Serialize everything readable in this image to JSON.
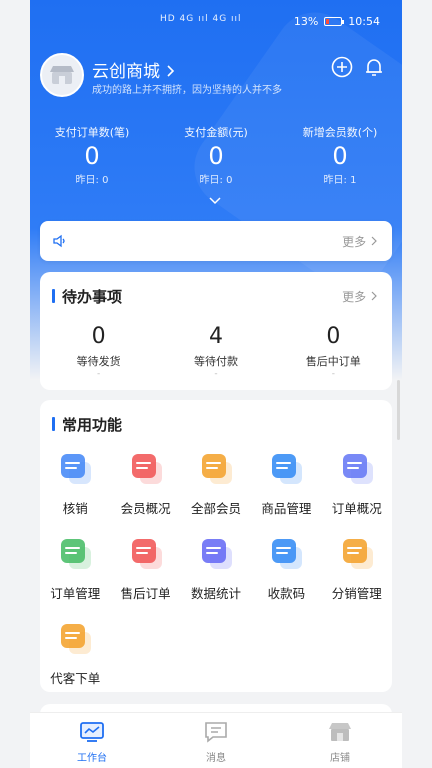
{
  "status_bar": {
    "battery": "13%",
    "time": "10:54",
    "signal": "HD 4G ııl 4G ııl"
  },
  "header": {
    "store_name": "云创商城",
    "slogan": "成功的路上并不拥挤，因为坚持的人并不多"
  },
  "stats": [
    {
      "label": "支付订单数(笔)",
      "value": "0",
      "yesterday": "昨日: 0"
    },
    {
      "label": "支付金额(元)",
      "value": "0",
      "yesterday": "昨日: 0"
    },
    {
      "label": "新增会员数(个)",
      "value": "0",
      "yesterday": "昨日: 1"
    }
  ],
  "notice": {
    "more": "更多"
  },
  "todo": {
    "title": "待办事项",
    "more": "更多",
    "items": [
      {
        "count": "0",
        "label": "等待发货",
        "dash": "-"
      },
      {
        "count": "4",
        "label": "等待付款",
        "dash": "-"
      },
      {
        "count": "0",
        "label": "售后中订单",
        "dash": "-"
      }
    ]
  },
  "functions": {
    "title": "常用功能",
    "items": [
      {
        "label": "核销",
        "icon": "verify-icon",
        "color": "#4a8cf7"
      },
      {
        "label": "会员概况",
        "icon": "member-overview-icon",
        "color": "#f25b5b"
      },
      {
        "label": "全部会员",
        "icon": "all-members-icon",
        "color": "#f4a533"
      },
      {
        "label": "商品管理",
        "icon": "cart-icon",
        "color": "#3a8ff5"
      },
      {
        "label": "订单概况",
        "icon": "order-overview-icon",
        "color": "#6a7cf5"
      },
      {
        "label": "订单管理",
        "icon": "order-manage-icon",
        "color": "#4cbf6a"
      },
      {
        "label": "售后订单",
        "icon": "after-sale-icon",
        "color": "#f25b5b"
      },
      {
        "label": "数据统计",
        "icon": "chart-icon",
        "color": "#6a6ff5"
      },
      {
        "label": "收款码",
        "icon": "payment-code-icon",
        "color": "#3a8ff5"
      },
      {
        "label": "分销管理",
        "icon": "distribution-icon",
        "color": "#f4a533"
      },
      {
        "label": "代客下单",
        "icon": "proxy-order-icon",
        "color": "#f4a533"
      }
    ]
  },
  "tabbar": [
    {
      "label": "工作台",
      "icon": "workbench-icon",
      "active": true
    },
    {
      "label": "消息",
      "icon": "message-icon",
      "active": false
    },
    {
      "label": "店铺",
      "icon": "shop-icon",
      "active": false
    }
  ],
  "colors": {
    "primary": "#1f6ff2",
    "background": "#f2f3f5"
  }
}
